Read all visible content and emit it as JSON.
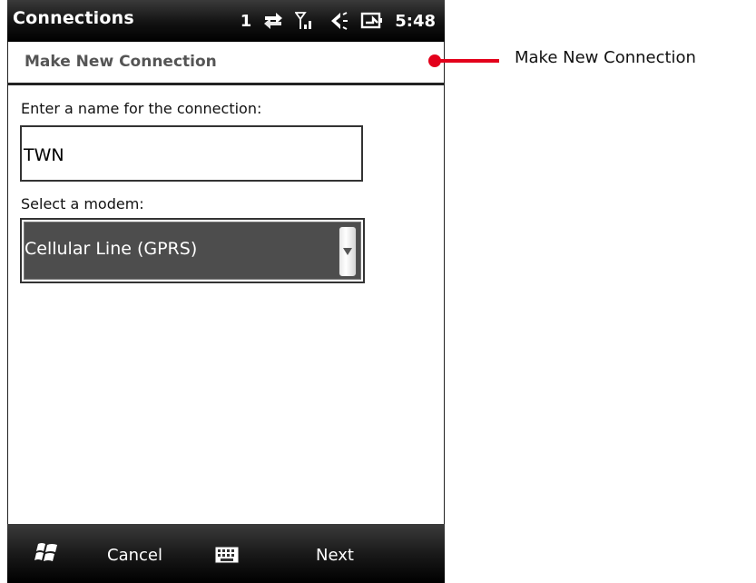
{
  "statusbar": {
    "title": "Connections",
    "notification_count": "1",
    "time": "5:48",
    "icons": [
      "data-transfer-icon",
      "signal-strength-icon",
      "speaker-icon",
      "battery-charging-icon"
    ]
  },
  "header": {
    "title": "Make New Connection"
  },
  "form": {
    "name_label": "Enter a name for the connection:",
    "name_value": "TWN",
    "modem_label": "Select a modem:",
    "modem_value": "Cellular Line (GPRS)"
  },
  "bottombar": {
    "start_icon": "windows-start-icon",
    "cancel_label": "Cancel",
    "keyboard_icon": "keyboard-icon",
    "next_label": "Next"
  },
  "annotation": {
    "text": "Make New Connection",
    "color": "#e3001b"
  }
}
